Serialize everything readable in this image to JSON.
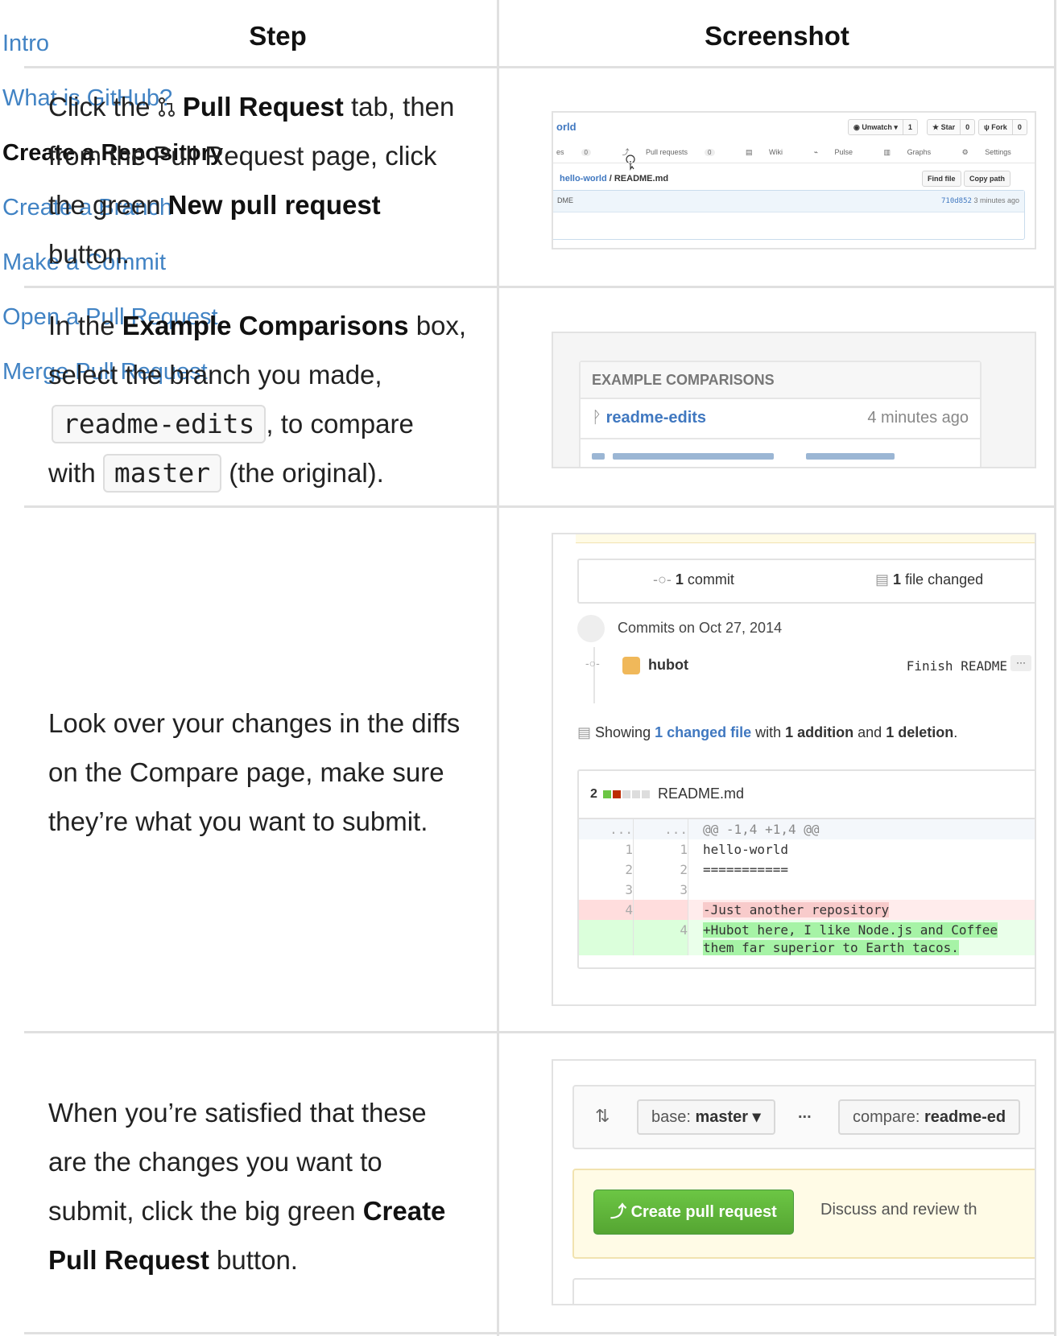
{
  "nav": {
    "items": [
      "Intro",
      "What is GitHub?",
      "Create a Repository",
      "Create a Branch",
      "Make a Commit",
      "Open a Pull Request",
      "Merge Pull Request"
    ]
  },
  "table": {
    "header_step": "Step",
    "header_screenshot": "Screenshot"
  },
  "steps": {
    "s1": {
      "l1a": "Click the",
      "l1b": "Pull Request",
      "l1c": "tab, then",
      "l2": "from the Pull Request page, click",
      "l3a": "the green",
      "l3b": "New pull request",
      "l4": "button."
    },
    "s2": {
      "l1a": "In the",
      "l1b": "Example Comparisons",
      "l1c": "box,",
      "l2": "select the branch you made,",
      "code1": "readme-edits",
      "l3b": ", to compare",
      "l4a": "with",
      "code2": "master",
      "l4b": "(the original)."
    },
    "s3": {
      "l1": "Look over your changes in the diffs",
      "l2": "on the Compare page, make sure",
      "l3": "they’re what you want to submit."
    },
    "s4": {
      "l1": "When you’re satisfied that these",
      "l2": "are the changes you want to",
      "l3a": "submit, click the big green",
      "l3b": "Create",
      "l4a": "Pull Request",
      "l4b": "button."
    }
  },
  "shot1": {
    "repo": "orld",
    "unwatch": "Unwatch ▾",
    "unwatch_count": "1",
    "star": "Star",
    "star_count": "0",
    "fork": "Fork",
    "fork_count": "0",
    "tab_issues": "es",
    "tab_issues_count": "0",
    "tab_pulls": "Pull requests",
    "tab_pulls_count": "0",
    "tab_wiki": "Wiki",
    "tab_pulse": "Pulse",
    "tab_graphs": "Graphs",
    "tab_settings": "Settings",
    "crumb_repo": "hello-world",
    "crumb_sep": " / ",
    "crumb_file": "README.md",
    "find_file": "Find file",
    "copy_path": "Copy path",
    "file_name": "DME",
    "sha": "710d852",
    "time": "3 minutes ago"
  },
  "shot2": {
    "header": "EXAMPLE COMPARISONS",
    "branch": "readme-edits",
    "time": "4 minutes ago"
  },
  "shot3": {
    "commits_count": "1",
    "commits_label": "commit",
    "files_count": "1",
    "files_label": "file changed",
    "commits_on": "Commits on Oct 27, 2014",
    "author": "hubot",
    "message": "Finish README",
    "dots": "···",
    "showing_a": "Showing ",
    "showing_link": "1 changed file",
    "showing_b": " with ",
    "showing_add": "1 addition",
    "showing_c": " and ",
    "showing_del": "1 deletion",
    "showing_d": ".",
    "diff_count": "2",
    "diff_file": "README.md",
    "lines": [
      {
        "kind": "hunk",
        "old": "...",
        "new": "...",
        "code": "@@ -1,4 +1,4 @@"
      },
      {
        "kind": "ctx",
        "old": "1",
        "new": "1",
        "code": " hello-world"
      },
      {
        "kind": "ctx",
        "old": "2",
        "new": "2",
        "code": " ==========="
      },
      {
        "kind": "ctx",
        "old": "3",
        "new": "3",
        "code": ""
      },
      {
        "kind": "del",
        "old": "4",
        "new": "",
        "code": "-Just another repository"
      },
      {
        "kind": "add",
        "old": "",
        "new": "4",
        "code": "+Hubot here, I like Node.js and Coffee"
      },
      {
        "kind": "add2",
        "old": "",
        "new": "",
        "code": " them far superior to Earth tacos."
      }
    ]
  },
  "shot4": {
    "base_label": "base: ",
    "base_value": "master ▾",
    "ellipsis": "...",
    "compare_label": "compare: ",
    "compare_value": "readme-ed",
    "create_button": "Create pull request",
    "description": "Discuss and review th"
  },
  "colors": {
    "link": "#4183c4",
    "green": "#55a532",
    "grid": "#e0e0e0"
  }
}
